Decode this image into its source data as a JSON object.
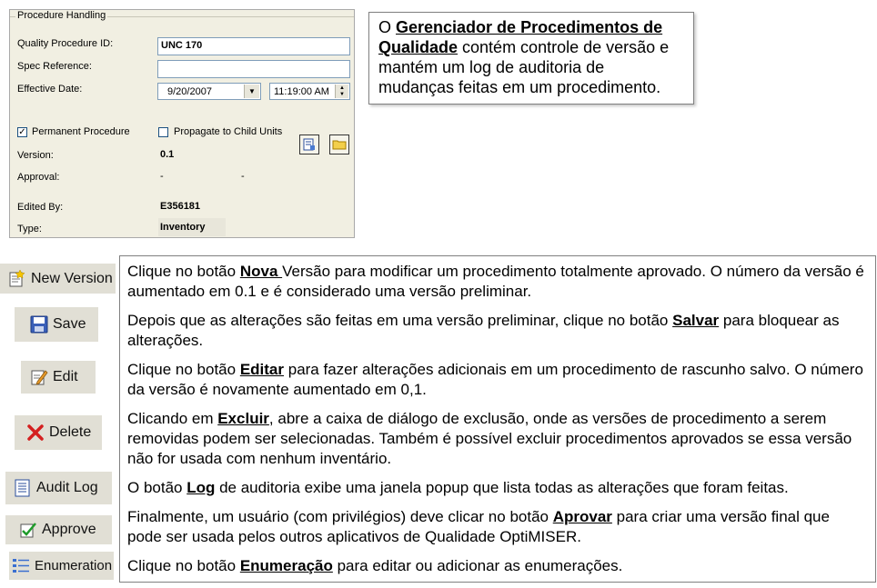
{
  "panel": {
    "legend": "Procedure Handling",
    "quality_procedure_id_label": "Quality Procedure ID:",
    "quality_procedure_id_value": "UNC 170",
    "spec_reference_label": "Spec Reference:",
    "spec_reference_value": "",
    "effective_date_label": "Effective Date:",
    "effective_date_value": "9/20/2007",
    "effective_time_value": "11:19:00 AM",
    "permanent_procedure_label": "Permanent Procedure",
    "permanent_procedure_checked": true,
    "propagate_label": "Propagate to Child Units",
    "propagate_checked": false,
    "version_label": "Version:",
    "version_value": "0.1",
    "approval_label": "Approval:",
    "approval_value_1": "-",
    "approval_value_2": "-",
    "edited_by_label": "Edited By:",
    "edited_by_value": "E356181",
    "type_label": "Type:",
    "type_value": "Inventory"
  },
  "infobox": {
    "pre": "O ",
    "bold": "Gerenciador de Procedimentos de Qualidade",
    "post": " contém controle de versão e mantém um log de auditoria de mudanças feitas em um procedimento."
  },
  "buttons": {
    "new_version": "New Version",
    "save": "Save",
    "edit": "Edit",
    "delete": "Delete",
    "audit_log": "Audit Log",
    "approve": "Approve",
    "enumeration": "Enumeration"
  },
  "descriptions": {
    "new_version": {
      "pre": "Clique no botão ",
      "bold": "Nova ",
      "post": "Versão para modificar um procedimento totalmente aprovado. O número da versão é aumentado em 0.1 e é considerado uma versão preliminar."
    },
    "save": {
      "pre": "Depois que as alterações são feitas em uma versão preliminar, clique no botão ",
      "bold": "Salvar",
      "post": " para bloquear as alterações."
    },
    "edit": {
      "pre": "Clique no botão ",
      "bold": "Editar",
      "post": " para fazer alterações adicionais em um procedimento de rascunho salvo. O número da versão é novamente aumentado em 0,1."
    },
    "delete": {
      "pre": "Clicando em ",
      "bold": "Excluir",
      "post": ", abre a caixa de diálogo de exclusão, onde as versões de procedimento a serem removidas podem ser selecionadas. Também é possível excluir procedimentos aprovados se essa versão não for usada com nenhum inventário."
    },
    "audit_log": {
      "pre": "O botão ",
      "bold": "Log",
      "post": " de auditoria exibe uma janela popup que lista todas as alterações que foram feitas."
    },
    "approve": {
      "pre": "Finalmente, um usuário (com privilégios) deve clicar no botão ",
      "bold": "Aprovar",
      "post": " para criar uma versão final que pode ser usada pelos outros aplicativos de Qualidade OptiMISER."
    },
    "enumeration": {
      "pre": "Clique no botão ",
      "bold": "Enumeração",
      "post": " para editar ou adicionar as enumerações."
    }
  }
}
